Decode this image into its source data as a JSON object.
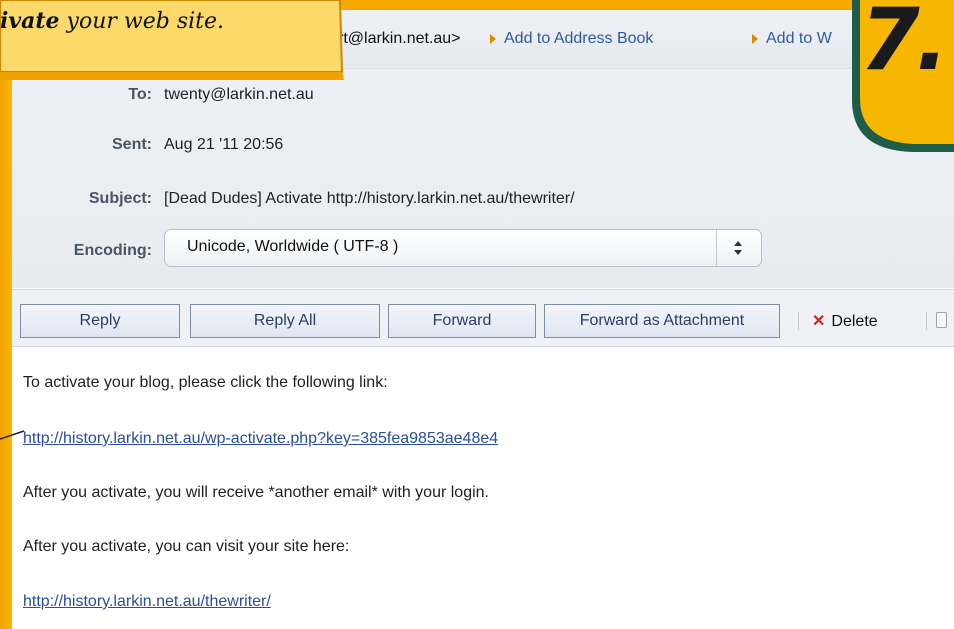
{
  "callout": {
    "text_bold": "ivate",
    "text_rest": " your web site."
  },
  "step_badge": {
    "number": "7."
  },
  "header": {
    "from_address": "rt@larkin.net.au>",
    "add_to_address_book": "Add to Address Book",
    "add_to_w": "Add to W",
    "to_label": "To:",
    "to_value": "twenty@larkin.net.au",
    "sent_label": "Sent:",
    "sent_value": "Aug 21 '11 20:56",
    "subject_label": "Subject:",
    "subject_value": "[Dead Dudes] Activate http://history.larkin.net.au/thewriter/",
    "encoding_label": "Encoding:",
    "encoding_value": "Unicode, Worldwide ( UTF-8 )"
  },
  "toolbar": {
    "reply": "Reply",
    "reply_all": "Reply All",
    "forward": "Forward",
    "forward_as_attachment": "Forward as Attachment",
    "delete": "Delete"
  },
  "body": {
    "line1": "To activate your blog, please click the following link:",
    "activation_link": "http://history.larkin.net.au/wp-activate.php?key=385fea9853ae48e4",
    "line3": "After you activate, you will receive *another email* with your login.",
    "line4": "After you activate, you can visit your site here:",
    "site_link": "http://history.larkin.net.au/thewriter/"
  },
  "colors": {
    "frame": "#f6a700",
    "link": "#2b4e9a",
    "badge_fill": "#f7b600",
    "badge_border": "#1f5c4a"
  }
}
